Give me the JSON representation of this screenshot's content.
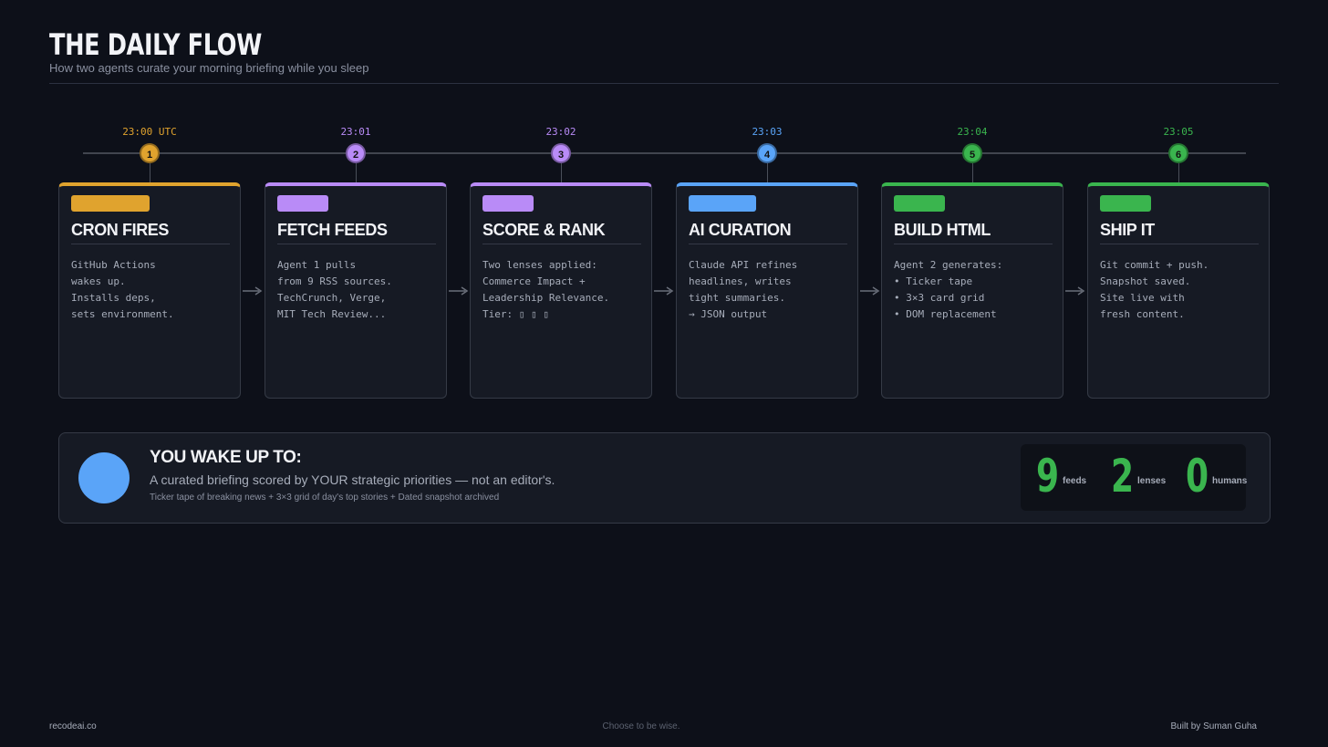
{
  "header": {
    "title": "THE DAILY FLOW",
    "subtitle": "How two agents curate your morning briefing while you sleep"
  },
  "colors": {
    "orange": "#e0a32e",
    "purple": "#b98bf7",
    "blue": "#5aa4f8",
    "green": "#3ab54e",
    "background": "#0d1019",
    "card": "#161a24"
  },
  "steps": [
    {
      "time": "23:00 UTC",
      "number": "1",
      "title": "CRON FIRES",
      "body": "GitHub Actions\nwakes up.\nInstalls deps,\nsets environment.",
      "color": "#e0a32e"
    },
    {
      "time": "23:01",
      "number": "2",
      "title": "FETCH FEEDS",
      "body": "Agent 1 pulls\nfrom 9 RSS sources.\nTechCrunch, Verge,\nMIT Tech Review...",
      "color": "#b98bf7"
    },
    {
      "time": "23:02",
      "number": "3",
      "title": "SCORE & RANK",
      "body": "Two lenses applied:\nCommerce Impact +\nLeadership Relevance.\nTier: ▯ ▯ ▯",
      "color": "#b98bf7"
    },
    {
      "time": "23:03",
      "number": "4",
      "title": "AI CURATION",
      "body": "Claude API refines\nheadlines, writes\ntight summaries.\n→ JSON output",
      "color": "#5aa4f8"
    },
    {
      "time": "23:04",
      "number": "5",
      "title": "BUILD HTML",
      "body": "Agent 2 generates:\n• Ticker tape\n• 3×3 card grid\n• DOM replacement",
      "color": "#3ab54e"
    },
    {
      "time": "23:05",
      "number": "6",
      "title": "SHIP IT",
      "body": "Git commit + push.\nSnapshot saved.\nSite live with\nfresh content.",
      "color": "#3ab54e"
    }
  ],
  "summary": {
    "title": "YOU WAKE UP TO:",
    "subtitle": "A curated briefing scored by YOUR strategic priorities — not an editor's.",
    "note": "Ticker tape of breaking news  +  3×3 grid of day's top stories  +  Dated snapshot archived",
    "stats": [
      {
        "value": "9",
        "label": "feeds"
      },
      {
        "value": "2",
        "label": "lenses"
      },
      {
        "value": "0",
        "label": "humans"
      }
    ]
  },
  "footer": {
    "left": "recodeai.co",
    "center": "Choose to be wise.",
    "right": "Built by Suman Guha"
  }
}
